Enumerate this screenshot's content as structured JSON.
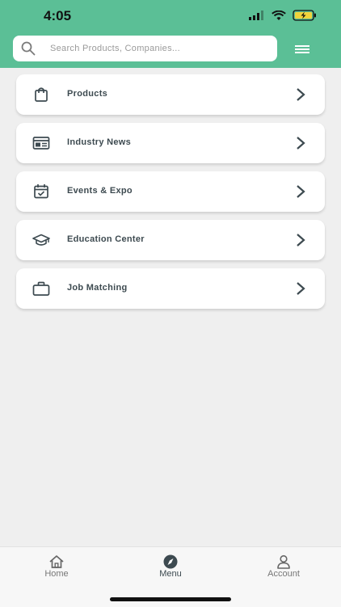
{
  "status_bar": {
    "time": "4:05"
  },
  "search": {
    "placeholder": "Search Products, Companies..."
  },
  "menu_items": [
    {
      "label": "Products",
      "icon": "shopping-bag-icon"
    },
    {
      "label": "Industry News",
      "icon": "newspaper-icon"
    },
    {
      "label": "Events & Expo",
      "icon": "calendar-check-icon"
    },
    {
      "label": "Education Center",
      "icon": "graduation-cap-icon"
    },
    {
      "label": "Job Matching",
      "icon": "briefcase-icon"
    }
  ],
  "tab_bar": {
    "items": [
      {
        "label": "Home",
        "icon": "home-icon"
      },
      {
        "label": "Menu",
        "icon": "compass-icon",
        "active": true
      },
      {
        "label": "Account",
        "icon": "user-icon"
      }
    ]
  },
  "colors": {
    "header": "#5bbf96",
    "icon": "#3d4a50",
    "background": "#efefef"
  }
}
